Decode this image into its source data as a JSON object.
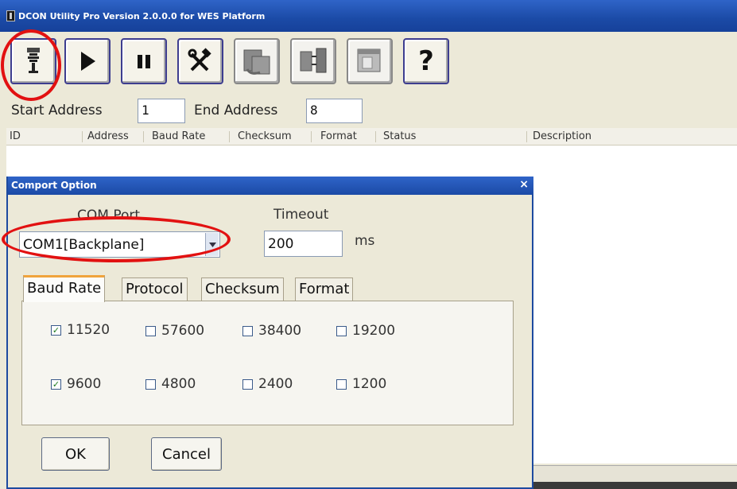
{
  "app": {
    "title": "DCON Utility Pro Version 2.0.0.0 for WES Platform"
  },
  "toolbar": {
    "buttons": [
      {
        "icon": "comport-icon"
      },
      {
        "icon": "play-icon"
      },
      {
        "icon": "pause-icon"
      },
      {
        "icon": "tools-icon"
      },
      {
        "icon": "module-icon"
      },
      {
        "icon": "io-module-icon"
      },
      {
        "icon": "window-icon"
      },
      {
        "icon": "help-icon"
      }
    ],
    "help_label": "?"
  },
  "search": {
    "start_label": "Start Address",
    "start_value": "1",
    "end_label": "End Address",
    "end_value": "8"
  },
  "table": {
    "columns": [
      "ID",
      "Address",
      "Baud Rate",
      "Checksum",
      "Format",
      "Status",
      "Description"
    ]
  },
  "dialog": {
    "title": "Comport Option",
    "close": "×",
    "com_label": "COM Port",
    "com_value": "COM1[Backplane]",
    "timeout_label": "Timeout",
    "timeout_value": "200",
    "timeout_unit": "ms",
    "tabs": [
      "Baud Rate",
      "Protocol",
      "Checksum",
      "Format"
    ],
    "active_tab": "Baud Rate",
    "baud_rates": [
      {
        "label": "11520",
        "checked": true
      },
      {
        "label": "57600",
        "checked": false
      },
      {
        "label": "38400",
        "checked": false
      },
      {
        "label": "19200",
        "checked": false
      },
      {
        "label": "9600",
        "checked": true
      },
      {
        "label": "4800",
        "checked": false
      },
      {
        "label": "2400",
        "checked": false
      },
      {
        "label": "1200",
        "checked": false
      }
    ],
    "ok_label": "OK",
    "cancel_label": "Cancel"
  },
  "colors": {
    "titlebar": "#1b4aa6",
    "highlight": "#e21111",
    "active_tab_accent": "#f0a43c"
  }
}
